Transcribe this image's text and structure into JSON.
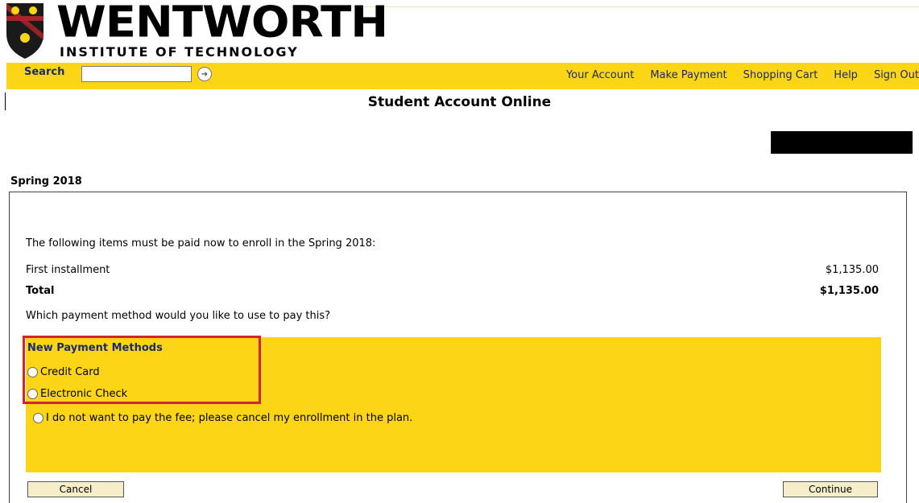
{
  "header": {
    "logo_main": "WENTWORTH",
    "logo_sub": "INSTITUTE OF TECHNOLOGY",
    "brand_colors": {
      "yellow": "#fcd516",
      "red": "#d0262c",
      "navy": "#1a2a6c"
    }
  },
  "navbar": {
    "search_label": "Search",
    "search_value": "",
    "search_go_icon": "arrow-circle-icon",
    "links": [
      "Your Account",
      "Make Payment",
      "Shopping Cart",
      "Help",
      "Sign Out"
    ]
  },
  "page": {
    "title": "Student Account Online",
    "term": "Spring 2018"
  },
  "payment": {
    "intro": "The following items must be paid now to enroll in the Spring 2018:",
    "item": {
      "name": "First installment",
      "amount": "$1,135.00"
    },
    "total": {
      "label": "Total",
      "amount": "$1,135.00"
    },
    "question": "Which payment method would you like to use to pay this?",
    "methods_heading": "New Payment Methods",
    "options": [
      "Credit Card",
      "Electronic Check",
      "I do not want to pay the fee; please cancel my enrollment in the plan."
    ]
  },
  "buttons": {
    "cancel": "Cancel",
    "continue": "Continue"
  }
}
